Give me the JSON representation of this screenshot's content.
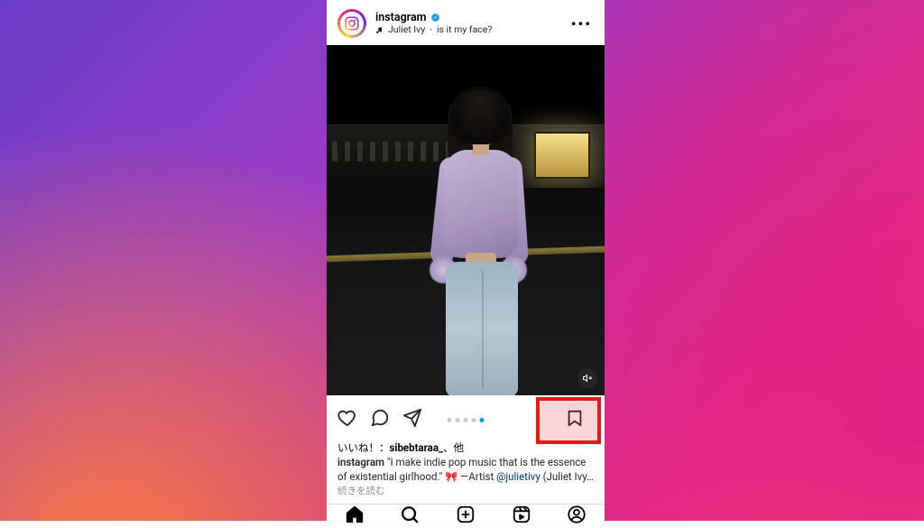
{
  "header": {
    "username": "instagram",
    "verified": true,
    "music_artist": "Juliet Ivy",
    "music_separator": " · ",
    "music_track": "is it my face?"
  },
  "carousel": {
    "count": 5,
    "active_index": 4
  },
  "likes": {
    "prefix": "いいね！：",
    "top_liker": "sibebtaraa_",
    "suffix": "、他"
  },
  "caption": {
    "username": "instagram",
    "text_before_emoji": " \"I make indie pop music that is the essence of existential girlhood.\" ",
    "emoji": "🎀",
    "artist_prefix": " —Artist ",
    "mention": "@julietivy",
    "after_mention": " (Juliet Ivy… ",
    "read_more": "続きを読む"
  },
  "icons": {
    "like": "heart-icon",
    "comment": "comment-icon",
    "share": "share-icon",
    "save": "bookmark-icon",
    "mute": "mute-icon",
    "more": "more-icon",
    "home": "home-icon",
    "search": "search-icon",
    "create": "create-icon",
    "reels": "reels-icon",
    "profile": "profile-icon",
    "music": "music-note-icon",
    "verified": "verified-badge-icon",
    "app_logo": "instagram-logo-icon"
  }
}
